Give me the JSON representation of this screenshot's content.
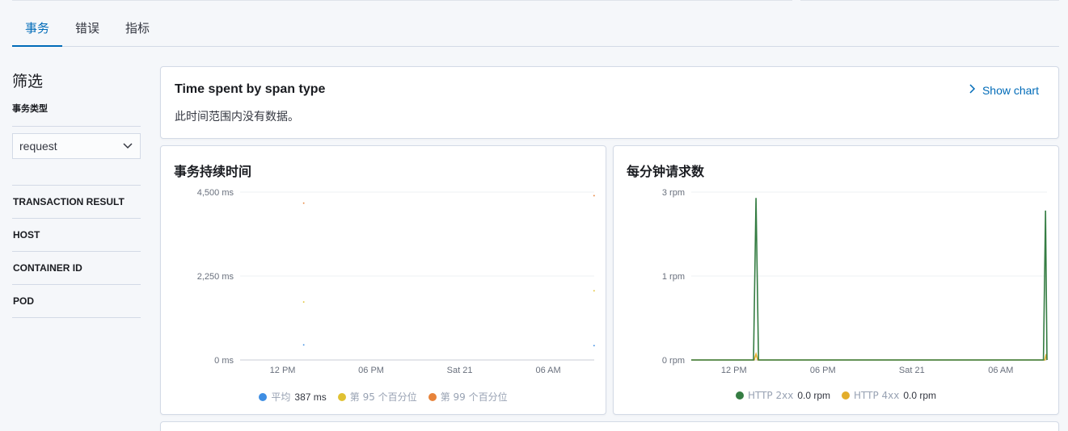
{
  "tabs": [
    {
      "label": "事务",
      "active": true
    },
    {
      "label": "错误",
      "active": false
    },
    {
      "label": "指标",
      "active": false
    }
  ],
  "sidebar": {
    "title": "筛选",
    "type_label": "事务类型",
    "type_select_value": "request",
    "filters": [
      "TRANSACTION RESULT",
      "HOST",
      "CONTAINER ID",
      "POD"
    ]
  },
  "span_panel": {
    "title": "Time spent by span type",
    "no_data": "此时间范围内没有数据。",
    "show_chart": "Show chart"
  },
  "colors": {
    "accent": "#006bb8",
    "avg": "#3f8ee3",
    "p95": "#e0c132",
    "p99": "#e7833a",
    "http2xx": "#357d43",
    "http4xx": "#e3ad2a"
  },
  "chart_data": [
    {
      "type": "scatter",
      "title": "事务持续时间",
      "y_ticks": [
        "4,500 ms",
        "2,250 ms",
        "0 ms"
      ],
      "ylim": [
        0,
        4500
      ],
      "x_ticks": [
        "12 PM",
        "06 PM",
        "Sat 21",
        "06 AM"
      ],
      "x_tick_positions": [
        0.12,
        0.37,
        0.62,
        0.87
      ],
      "series": [
        {
          "name": "平均",
          "legend_value": "387 ms",
          "points": [
            [
              0.18,
              400
            ],
            [
              1.0,
              380
            ]
          ]
        },
        {
          "name": "第 95 个百分位",
          "legend_value": "",
          "points": [
            [
              0.18,
              1550
            ],
            [
              1.0,
              1850
            ]
          ]
        },
        {
          "name": "第 99 个百分位",
          "legend_value": "",
          "points": [
            [
              0.18,
              4200
            ],
            [
              1.0,
              4400
            ]
          ]
        }
      ]
    },
    {
      "type": "line",
      "title": "每分钟请求数",
      "y_ticks": [
        "3 rpm",
        "1 rpm",
        "0 rpm"
      ],
      "ylim": [
        0,
        2
      ],
      "x_ticks": [
        "12 PM",
        "06 PM",
        "Sat 21",
        "06 AM"
      ],
      "x_tick_positions": [
        0.12,
        0.37,
        0.62,
        0.87
      ],
      "series": [
        {
          "name": "HTTP 2xx",
          "legend_value": "0.0 rpm",
          "points": [
            [
              0,
              0
            ],
            [
              0.175,
              0
            ],
            [
              0.182,
              1.93
            ],
            [
              0.189,
              0
            ],
            [
              0.99,
              0
            ],
            [
              0.996,
              1.78
            ],
            [
              1.0,
              0
            ]
          ]
        },
        {
          "name": "HTTP 4xx",
          "legend_value": "0.0 rpm",
          "points": [
            [
              0,
              0
            ],
            [
              0.177,
              0
            ],
            [
              0.182,
              0.07
            ],
            [
              0.187,
              0
            ],
            [
              0.994,
              0
            ],
            [
              0.998,
              0.07
            ],
            [
              1.0,
              0
            ]
          ]
        }
      ]
    }
  ]
}
